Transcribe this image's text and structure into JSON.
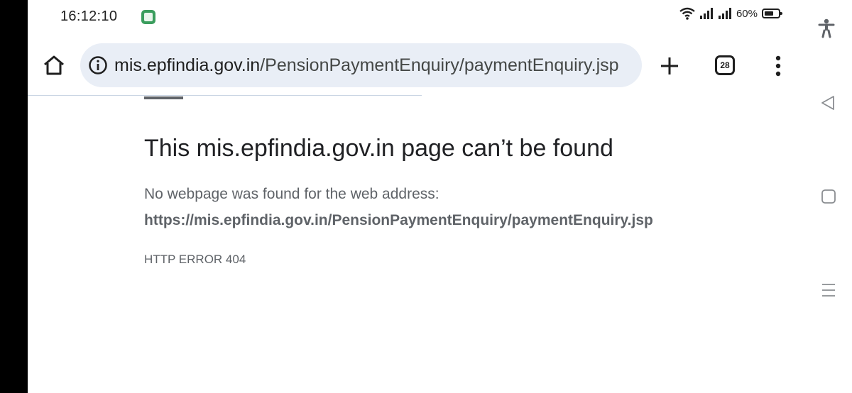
{
  "status_bar": {
    "time": "16:12:10",
    "app_icon": "calendar-app-icon",
    "wifi_icon": "wifi-icon",
    "signal_icon": "cellular-signal-icon",
    "battery_percent": "60%"
  },
  "toolbar": {
    "url_host": "mis.epfindia.gov.in",
    "url_path": "/PensionPaymentEnquiry/paymentEnquiry.jsp",
    "tab_count": "28",
    "home_icon": "home-icon",
    "info_icon": "info-icon",
    "new_tab_icon": "plus-icon",
    "menu_icon": "more-vert-icon"
  },
  "error_page": {
    "title": "This mis.epfindia.gov.in page can’t be found",
    "description": "No webpage was found for the web address:",
    "url": "https://mis.epfindia.gov.in/PensionPaymentEnquiry/paymentEnquiry.jsp",
    "error_code": "HTTP ERROR 404"
  },
  "nav_bar": {
    "icons": [
      "accessibility-icon",
      "back-icon",
      "home-square-icon",
      "recents-icon"
    ]
  },
  "colors": {
    "omnibox_bg": "#e9eef6",
    "title_text": "#202124",
    "body_text": "#5f6368"
  }
}
